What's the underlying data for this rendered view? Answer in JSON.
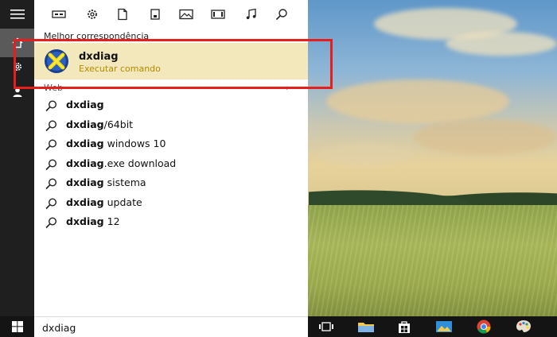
{
  "search_panel": {
    "best_match_label": "Melhor correspondência",
    "best_match": {
      "title": "dxdiag",
      "subtitle": "Executar comando"
    },
    "web_label": "Web",
    "suggestions": [
      {
        "bold": "dxdiag",
        "rest": ""
      },
      {
        "bold": "dxdiag",
        "rest": "/64bit"
      },
      {
        "bold": "dxdiag",
        "rest": " windows 10"
      },
      {
        "bold": "dxdiag",
        "rest": ".exe download"
      },
      {
        "bold": "dxdiag",
        "rest": " sistema"
      },
      {
        "bold": "dxdiag",
        "rest": " update"
      },
      {
        "bold": "dxdiag",
        "rest": " 12"
      }
    ]
  },
  "search_box": {
    "value": "dxdiag"
  },
  "filters": [
    "apps",
    "settings",
    "documents",
    "folders",
    "photos",
    "videos",
    "music",
    "web-search"
  ],
  "rail": [
    "hamburger-menu",
    "home",
    "settings",
    "account"
  ],
  "taskbar": [
    "task-view",
    "file-explorer",
    "store",
    "photos",
    "chrome",
    "paint"
  ],
  "colors": {
    "best_match_bg": "#f3e8bb",
    "best_match_sub": "#b28a00",
    "highlight_frame": "#e51e1e",
    "rail_bg": "#1f1f1f",
    "taskbar_bg": "#141414"
  }
}
